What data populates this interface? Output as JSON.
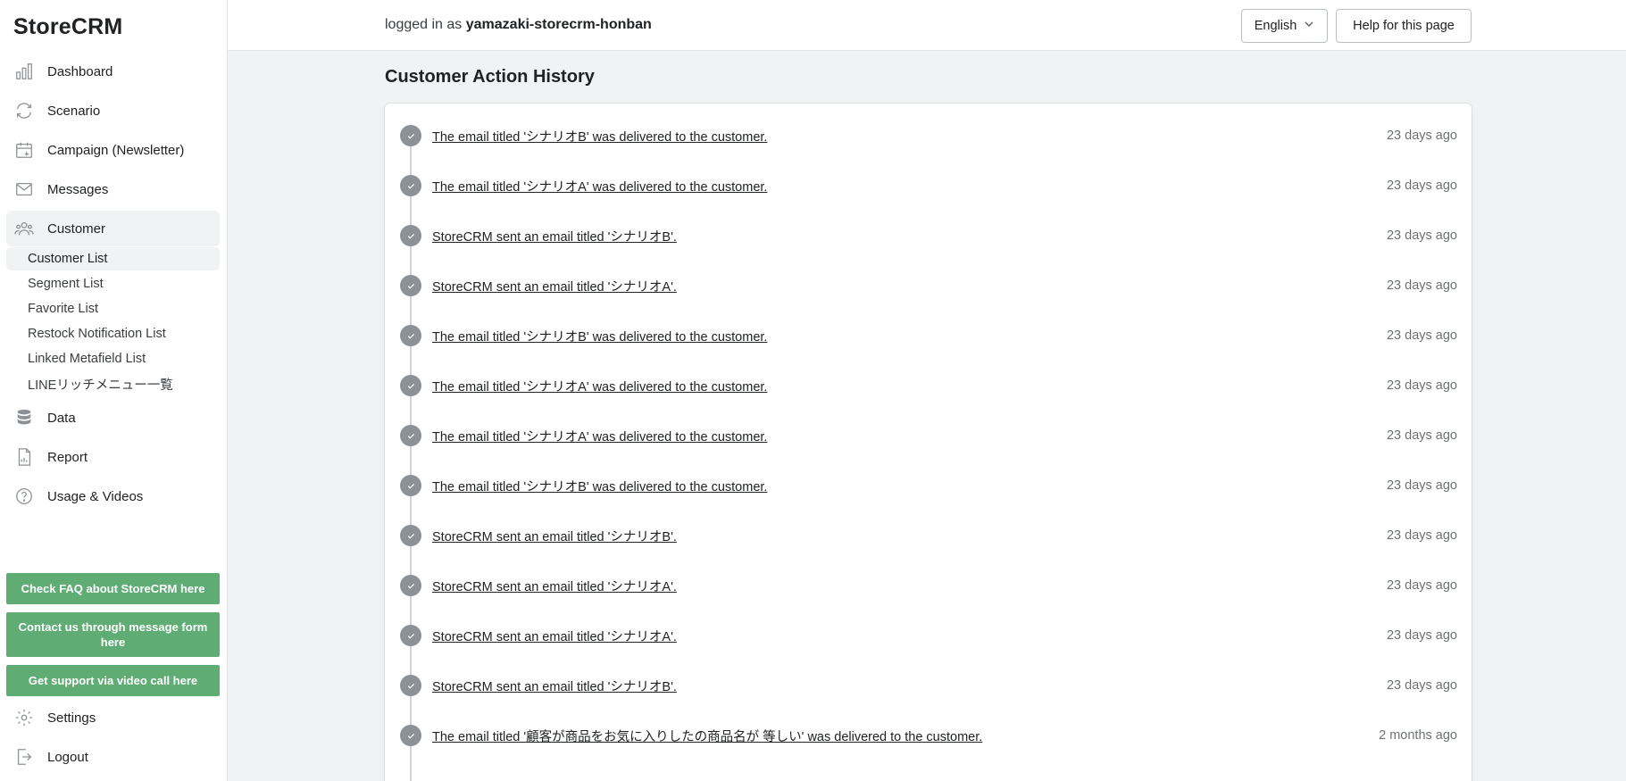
{
  "app": {
    "logo": "StoreCRM"
  },
  "sidebar": {
    "items": [
      {
        "label": "Dashboard",
        "icon": "bar-chart-icon"
      },
      {
        "label": "Scenario",
        "icon": "refresh-icon"
      },
      {
        "label": "Campaign (Newsletter)",
        "icon": "calendar-icon"
      },
      {
        "label": "Messages",
        "icon": "mail-icon"
      },
      {
        "label": "Customer",
        "icon": "customers-icon"
      },
      {
        "label": "Data",
        "icon": "database-icon"
      },
      {
        "label": "Report",
        "icon": "report-icon"
      },
      {
        "label": "Usage & Videos",
        "icon": "help-circle-icon"
      }
    ],
    "customer_sub": [
      "Customer List",
      "Segment List",
      "Favorite List",
      "Restock Notification List",
      "Linked Metafield List",
      "LINEリッチメニュー一覧"
    ],
    "support_buttons": [
      "Check FAQ about StoreCRM here",
      "Contact us through message form here",
      "Get support via video call here"
    ],
    "settings": "Settings",
    "logout": "Logout",
    "accent_color": "#5fad75"
  },
  "header": {
    "login_prefix": "logged in as",
    "username": "yamazaki-storecrm-honban",
    "language": "English",
    "help_label": "Help for this page"
  },
  "main": {
    "title": "Customer Action History",
    "events": [
      {
        "text": "The email titled 'シナリオB' was delivered to the customer.",
        "time": "23 days ago"
      },
      {
        "text": "The email titled 'シナリオA' was delivered to the customer.",
        "time": "23 days ago"
      },
      {
        "text": "StoreCRM sent an email titled 'シナリオB'.",
        "time": "23 days ago"
      },
      {
        "text": "StoreCRM sent an email titled 'シナリオA'.",
        "time": "23 days ago"
      },
      {
        "text": "The email titled 'シナリオB' was delivered to the customer.",
        "time": "23 days ago"
      },
      {
        "text": "The email titled 'シナリオA' was delivered to the customer.",
        "time": "23 days ago"
      },
      {
        "text": "The email titled 'シナリオA' was delivered to the customer.",
        "time": "23 days ago"
      },
      {
        "text": "The email titled 'シナリオB' was delivered to the customer.",
        "time": "23 days ago"
      },
      {
        "text": "StoreCRM sent an email titled 'シナリオB'.",
        "time": "23 days ago"
      },
      {
        "text": "StoreCRM sent an email titled 'シナリオA'.",
        "time": "23 days ago"
      },
      {
        "text": "StoreCRM sent an email titled 'シナリオA'.",
        "time": "23 days ago"
      },
      {
        "text": "StoreCRM sent an email titled 'シナリオB'.",
        "time": "23 days ago"
      },
      {
        "text": "The email titled '顧客が商品をお気に入りしたの商品名が 等しい' was delivered to the customer.",
        "time": "2 months ago"
      }
    ]
  }
}
